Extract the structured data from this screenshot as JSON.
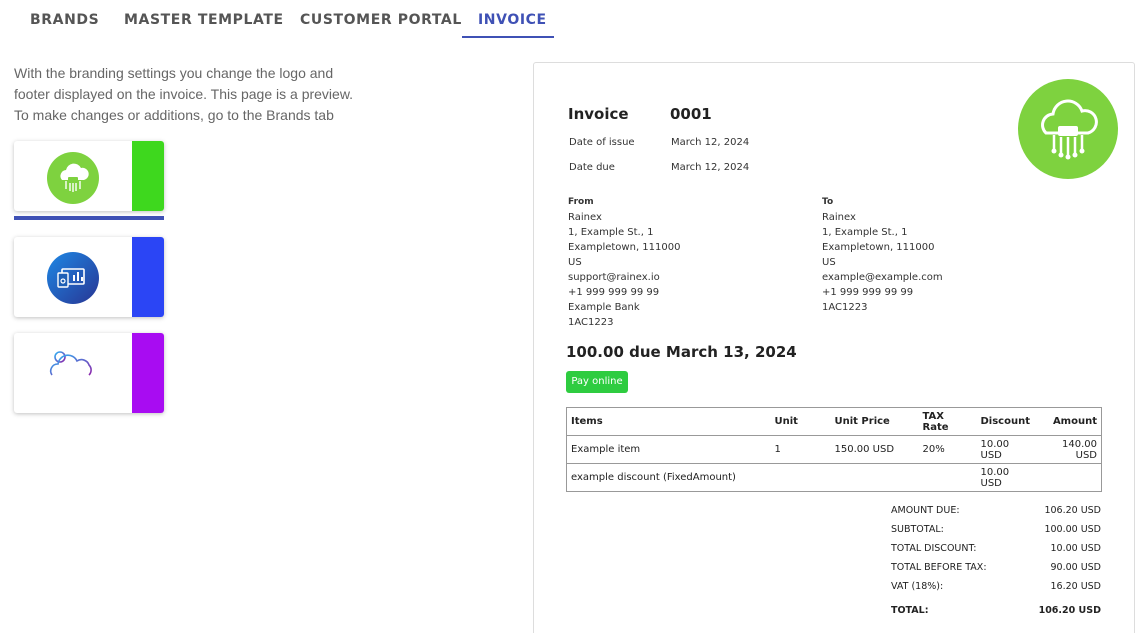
{
  "tabs": [
    {
      "label": "BRANDS"
    },
    {
      "label": "MASTER TEMPLATE"
    },
    {
      "label": "CUSTOMER PORTAL"
    },
    {
      "label": "INVOICE",
      "active": true
    }
  ],
  "description": {
    "line1": "With the branding settings you change the logo and",
    "line2": "footer displayed on the invoice. This page is a preview.",
    "line3": "To make changes or additions, go to the Brands tab"
  },
  "brands": [
    {
      "name": "cloud-chip-logo",
      "stripe_color": "#3ed81e",
      "selected": true
    },
    {
      "name": "dashboard-logo",
      "stripe_color": "#2b45f5",
      "selected": false
    },
    {
      "name": "cloud-gear-logo",
      "stripe_color": "#a80cf2",
      "selected": false
    }
  ],
  "invoice": {
    "title": "Invoice",
    "number": "0001",
    "issue_label": "Date of issue",
    "issue_date": "March 12, 2024",
    "due_label": "Date due",
    "due_date": "March 12, 2024",
    "from": {
      "heading": "From",
      "lines": [
        "Rainex",
        "1, Example St., 1",
        "Exampletown, 111000",
        "US",
        "support@rainex.io",
        "+1 999 999 99 99",
        "Example Bank",
        "1AC1223"
      ]
    },
    "to": {
      "heading": "To",
      "lines": [
        "Rainex",
        "1, Example St., 1",
        "Exampletown, 111000",
        "US",
        "example@example.com",
        "+1 999 999 99 99",
        "1AC1223"
      ]
    },
    "amount_due_heading": "100.00 due March 13, 2024",
    "pay_button": "Pay online",
    "logo_color": "#7ed23f",
    "table": {
      "headers": [
        "Items",
        "Unit",
        "Unit Price",
        "TAX Rate",
        "Discount",
        "Amount"
      ],
      "rows": [
        [
          "Example item",
          "1",
          "150.00 USD",
          "20%",
          "10.00 USD",
          "140.00 USD"
        ],
        [
          "example discount (FixedAmount)",
          "",
          "",
          "",
          "10.00 USD",
          ""
        ]
      ]
    },
    "totals": [
      {
        "label": "AMOUNT DUE:",
        "value": "106.20 USD"
      },
      {
        "label": "SUBTOTAL:",
        "value": "100.00 USD"
      },
      {
        "label": "TOTAL DISCOUNT:",
        "value": "10.00 USD"
      },
      {
        "label": "TOTAL BEFORE TAX:",
        "value": "90.00 USD"
      },
      {
        "label": "VAT (18%):",
        "value": "16.20 USD"
      }
    ],
    "grand_total": {
      "label": "TOTAL:",
      "value": "106.20 USD"
    }
  }
}
